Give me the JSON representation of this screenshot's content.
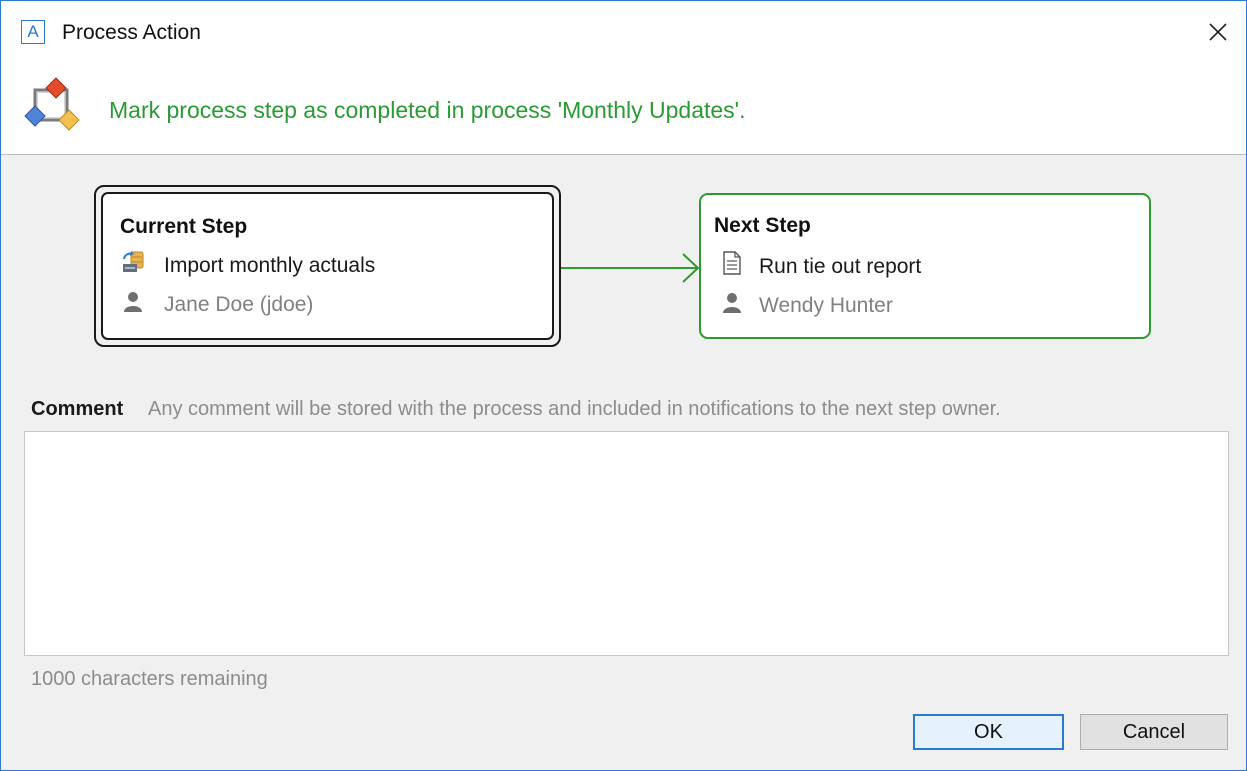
{
  "window": {
    "title": "Process Action",
    "app_icon_letter": "A"
  },
  "header": {
    "message": "Mark process step as completed in process 'Monthly Updates'.",
    "message_color": "#2a9a34",
    "icon": "process-diagram-icon"
  },
  "current_step": {
    "heading": "Current Step",
    "task": "Import monthly actuals",
    "task_icon": "import-data-icon",
    "owner": "Jane Doe (jdoe)",
    "owner_icon": "user-icon"
  },
  "next_step": {
    "heading": "Next Step",
    "task": "Run tie out report",
    "task_icon": "report-icon",
    "owner": "Wendy Hunter",
    "owner_icon": "user-icon",
    "border_color": "#2f9a2f"
  },
  "comment": {
    "label": "Comment",
    "hint": "Any comment will be stored with the process and included in notifications to the next step owner.",
    "value": "",
    "chars_remaining": "1000 characters remaining"
  },
  "buttons": {
    "ok": "OK",
    "cancel": "Cancel"
  }
}
